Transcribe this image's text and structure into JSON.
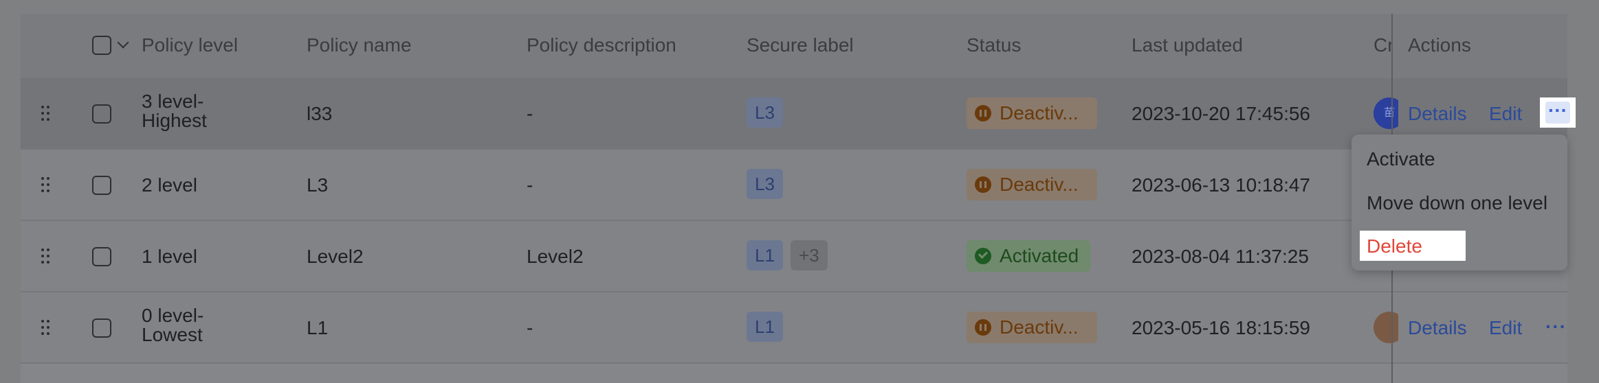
{
  "header": {
    "policy_level": "Policy level",
    "policy_name": "Policy name",
    "policy_description": "Policy description",
    "secure_label": "Secure label",
    "status": "Status",
    "last_updated": "Last updated",
    "creator_partial": "Cr",
    "actions": "Actions"
  },
  "rows": [
    {
      "level_line1": "3 level-",
      "level_line2": "Highest",
      "name": "l33",
      "description": "-",
      "labels": [
        "L3"
      ],
      "status": "Deactiv...",
      "updated": "2023-10-20 17:45:56",
      "avatar_text": "苗",
      "details": "Details",
      "edit": "Edit",
      "more": "···"
    },
    {
      "level_line1": "2 level",
      "name": "L3",
      "description": "-",
      "labels": [
        "L3"
      ],
      "status": "Deactiv...",
      "updated": "2023-06-13 10:18:47"
    },
    {
      "level_line1": "1 level",
      "name": "Level2",
      "description": "Level2",
      "labels": [
        "L1",
        "+3"
      ],
      "status": "Activated",
      "updated": "2023-08-04 11:37:25"
    },
    {
      "level_line1": "0 level-",
      "level_line2": "Lowest",
      "name": "L1",
      "description": "-",
      "labels": [
        "L1"
      ],
      "status": "Deactiv...",
      "updated": "2023-05-16 18:15:59",
      "details": "Details",
      "edit": "Edit",
      "more": "···"
    }
  ],
  "menu": {
    "activate": "Activate",
    "move_down": "Move down one level",
    "delete": "Delete"
  },
  "colors": {
    "delete": "#e0473a",
    "link": "#3b64d8",
    "deactivated": "#6a3a0c",
    "activated": "#1e5a22"
  }
}
